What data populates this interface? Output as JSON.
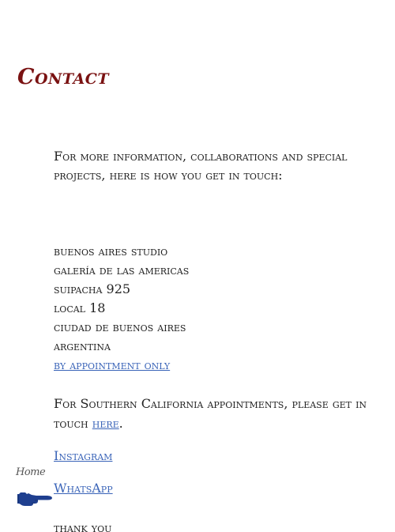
{
  "page": {
    "title": "Contact"
  },
  "intro": "For more information, collaborations and special projects, here is how you get in touch:",
  "address": {
    "lines": [
      "buenos aires studio",
      "galería de las americas",
      "suipacha 925",
      "local 18",
      "ciudad de buenos aires",
      "argentina"
    ],
    "appointment_link": "by appointment only"
  },
  "socal": {
    "text_before": "For Southern California appointments, please get in touch ",
    "link": "here",
    "text_after": "."
  },
  "social": {
    "instagram": "Instagram",
    "whatsapp": "WhatsApp"
  },
  "closing": "thank you",
  "nav": {
    "home_label": "Home",
    "icon": "pointing-hand-icon"
  },
  "colors": {
    "title": "#7a1212",
    "link": "#3a64b8",
    "hand": "#1f3f8f"
  }
}
